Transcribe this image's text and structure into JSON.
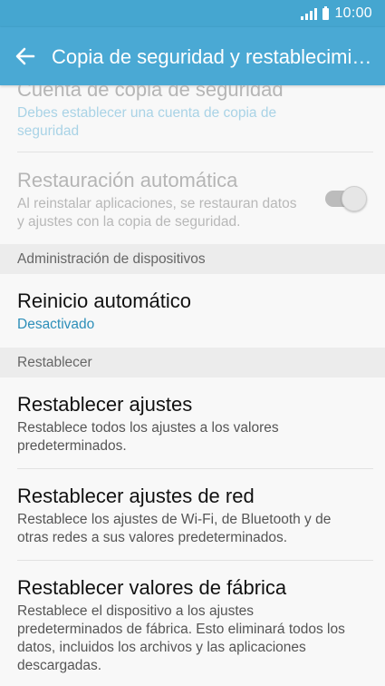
{
  "status_bar": {
    "time": "10:00",
    "signal_icon": "signal-icon",
    "battery_icon": "battery-icon"
  },
  "app_bar": {
    "back_icon": "arrow-left-icon",
    "title": "Copia de seguridad y restablecimiento"
  },
  "items": {
    "backup_account": {
      "title": "Cuenta de copia de seguridad",
      "subtitle": "Debes establecer una cuenta de copia de seguridad"
    },
    "auto_restore": {
      "title": "Restauración automática",
      "subtitle": "Al reinstalar aplicaciones, se restauran datos y ajustes con la copia de seguridad.",
      "toggle_on": true
    },
    "auto_restart": {
      "title": "Reinicio automático",
      "value": "Desactivado"
    },
    "reset_settings": {
      "title": "Restablecer ajustes",
      "subtitle": "Restablece todos los ajustes a los valores predeterminados."
    },
    "reset_network": {
      "title": "Restablecer ajustes de red",
      "subtitle": "Restablece los ajustes de Wi-Fi, de Bluetooth y de otras redes a sus valores predeterminados."
    },
    "factory_reset": {
      "title": "Restablecer valores de fábrica",
      "subtitle": "Restablece el dispositivo a los ajustes predeterminados de fábrica. Esto eliminará todos los datos, incluidos los archivos y las aplicaciones descargadas."
    }
  },
  "sections": {
    "device_admin": "Administración de dispositivos",
    "reset": "Restablecer"
  },
  "colors": {
    "app_bar": "#4aa9d4",
    "accent": "#2d8fb9",
    "background": "#f8f8f8",
    "section_bg": "#ececec"
  }
}
